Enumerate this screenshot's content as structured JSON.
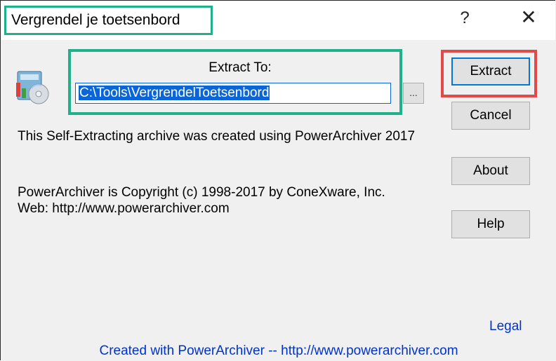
{
  "window": {
    "title": "Vergrendel je toetsenbord",
    "help_glyph": "?",
    "close_glyph": "✕"
  },
  "extract": {
    "label": "Extract To:",
    "path": "C:\\Tools\\VergrendelToetsenbord",
    "browse_label": "..."
  },
  "info": {
    "line1": "This Self-Extracting archive was created using PowerArchiver 2017",
    "line2": "PowerArchiver is Copyright (c) 1998-2017 by ConeXware, Inc.",
    "line3": "Web: http://www.powerarchiver.com"
  },
  "buttons": {
    "extract": "Extract",
    "cancel": "Cancel",
    "about": "About",
    "help": "Help"
  },
  "links": {
    "legal": "Legal",
    "footer": "Created with PowerArchiver  --  http://www.powerarchiver.com"
  },
  "colors": {
    "highlight_green": "#1fb28a",
    "highlight_red": "#e24a4a",
    "link_blue": "#0033cc",
    "selection_blue": "#0a66d8"
  }
}
